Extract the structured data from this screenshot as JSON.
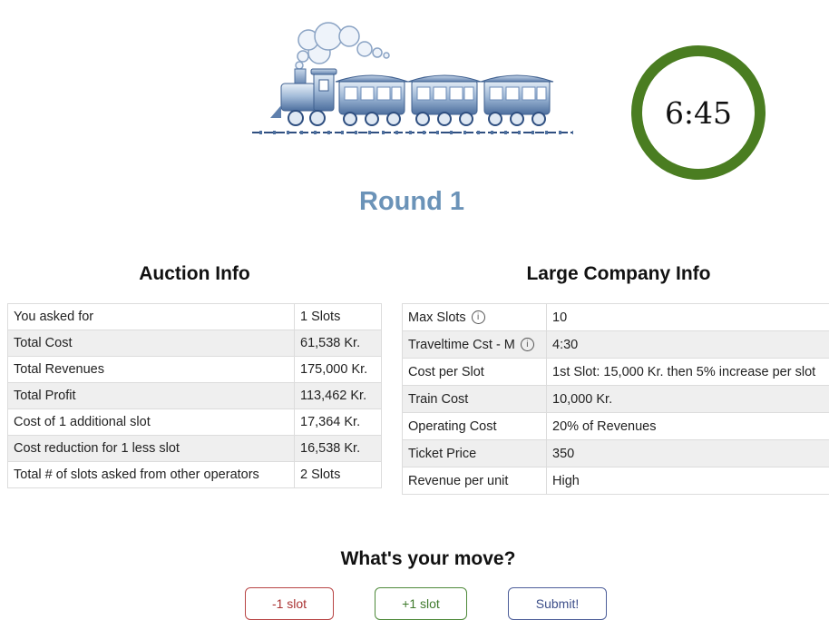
{
  "timer": {
    "value": "6:45",
    "ring_color": "#4a7d21"
  },
  "round": {
    "title": "Round 1",
    "color": "#6b93b8"
  },
  "auction": {
    "title": "Auction Info",
    "rows": [
      {
        "label": "You asked for",
        "value": "1 Slots"
      },
      {
        "label": "Total Cost",
        "value": "61,538 Kr."
      },
      {
        "label": "Total Revenues",
        "value": "175,000 Kr."
      },
      {
        "label": "Total Profit",
        "value": "113,462 Kr."
      },
      {
        "label": "Cost of 1 additional slot",
        "value": "17,364 Kr."
      },
      {
        "label": "Cost reduction for 1 less slot",
        "value": "16,538 Kr."
      },
      {
        "label": "Total # of slots asked from other operators",
        "value": "2 Slots"
      }
    ]
  },
  "company": {
    "title": "Large Company Info",
    "rows": [
      {
        "label": "Max Slots",
        "value": "10",
        "info_icon": true
      },
      {
        "label": "Traveltime Cst - M",
        "value": "4:30",
        "info_icon": true
      },
      {
        "label": "Cost per Slot",
        "value": "1st Slot: 15,000 Kr. then 5% increase per slot"
      },
      {
        "label": "Train Cost",
        "value": "10,000 Kr."
      },
      {
        "label": "Operating Cost",
        "value": "20% of Revenues"
      },
      {
        "label": "Ticket Price",
        "value": "350"
      },
      {
        "label": "Revenue per unit",
        "value": "High"
      }
    ]
  },
  "move": {
    "title": "What's your move?",
    "minus_label": "-1 slot",
    "plus_label": "+1 slot",
    "submit_label": "Submit!"
  },
  "icons": {
    "info": "info-circle-icon",
    "logo": "train-logo"
  }
}
